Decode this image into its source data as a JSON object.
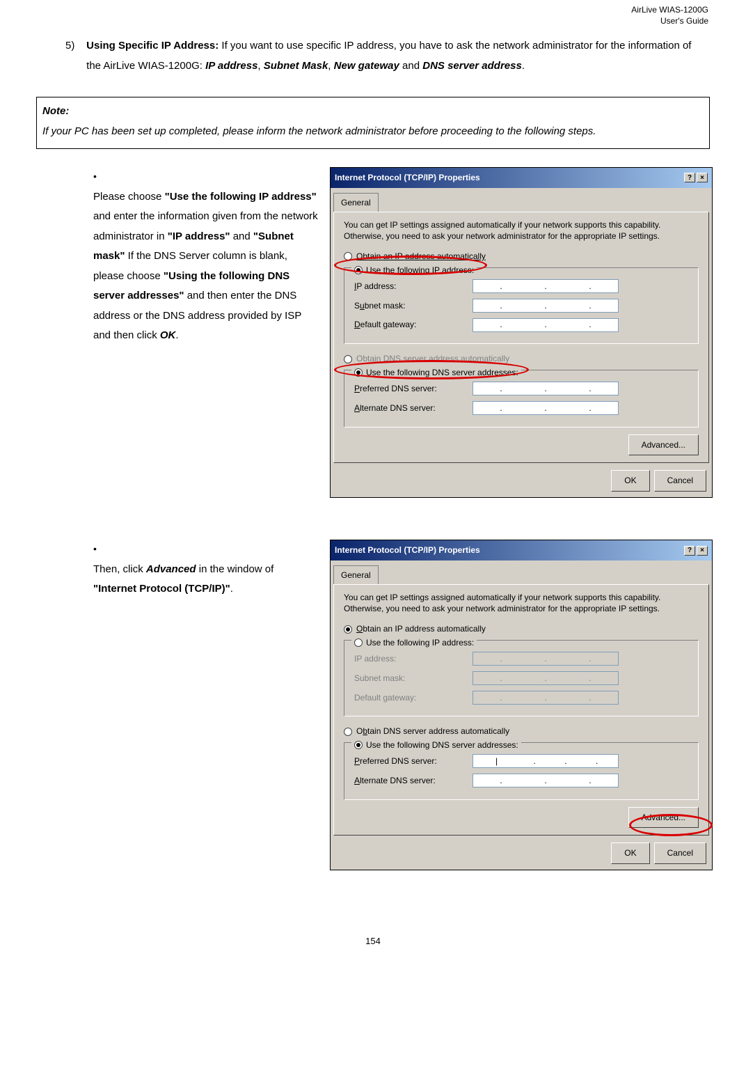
{
  "header": {
    "product": "AirLive WIAS-1200G",
    "doc": "User's Guide"
  },
  "section5": {
    "number": "5)",
    "title_bold": "Using Specific IP Address:",
    "text_after_title": " If you want to use specific IP address, you have to ask the network administrator for the information of the AirLive WIAS-1200G: ",
    "b1": "IP address",
    "sep1": ", ",
    "b2": "Subnet Mask",
    "sep2": ", ",
    "b3": "New gateway",
    "sep3": " and ",
    "b4": "DNS server address",
    "sep4": "."
  },
  "note": {
    "label": "Note:",
    "text": "If your PC has been set up completed, please inform the network administrator before proceeding to the following steps."
  },
  "bullet1": {
    "pre": "Please choose ",
    "b1": "\"Use the following IP address\"",
    "t1": " and enter the information given from the network administrator in ",
    "b2": "\"IP address\"",
    "t2": " and ",
    "b3": "\"Subnet mask\"",
    "t3": " If the DNS Server column is blank, please choose ",
    "b4": "\"Using the following DNS server addresses\"",
    "t4": " and then enter the DNS address or the DNS address provided by ISP and then click ",
    "b5": "OK",
    "t5": "."
  },
  "bullet2": {
    "pre": "Then, click ",
    "b1": "Advanced",
    "t1": " in the window of ",
    "b2": "\"Internet Protocol (TCP/IP)\"",
    "t2": "."
  },
  "dialog": {
    "title": "Internet Protocol (TCP/IP) Properties",
    "tab_general": "General",
    "desc": "You can get IP settings assigned automatically if your network supports this capability. Otherwise, you need to ask your network administrator for the appropriate IP settings.",
    "r_obtain_ip": "Obtain an IP address automatically",
    "r_use_ip": "Use the following IP address:",
    "f_ip": "IP address:",
    "f_subnet": "Subnet mask:",
    "f_gateway": "Default gateway:",
    "r_obtain_dns": "Obtain DNS server address automatically",
    "r_use_dns": "Use the following DNS server addresses:",
    "f_pref_dns": "Preferred DNS server:",
    "f_alt_dns": "Alternate DNS server:",
    "btn_advanced": "Advanced...",
    "btn_ok": "OK",
    "btn_cancel": "Cancel"
  },
  "page_number": "154"
}
